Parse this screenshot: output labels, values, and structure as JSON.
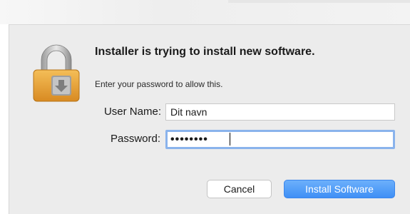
{
  "dialog": {
    "title": "Installer is trying to install new software.",
    "subtitle": "Enter your password to allow this.",
    "icon": "lock-icon",
    "fields": {
      "user_label": "User Name:",
      "user_value": "Dit navn",
      "password_label": "Password:",
      "password_value": "••••••••"
    },
    "buttons": {
      "cancel_label": "Cancel",
      "install_label": "Install Software"
    },
    "colors": {
      "accent": "#3f8ff5",
      "focus_ring": "#8ab3ec",
      "lock_body": "#e7a23b"
    }
  }
}
